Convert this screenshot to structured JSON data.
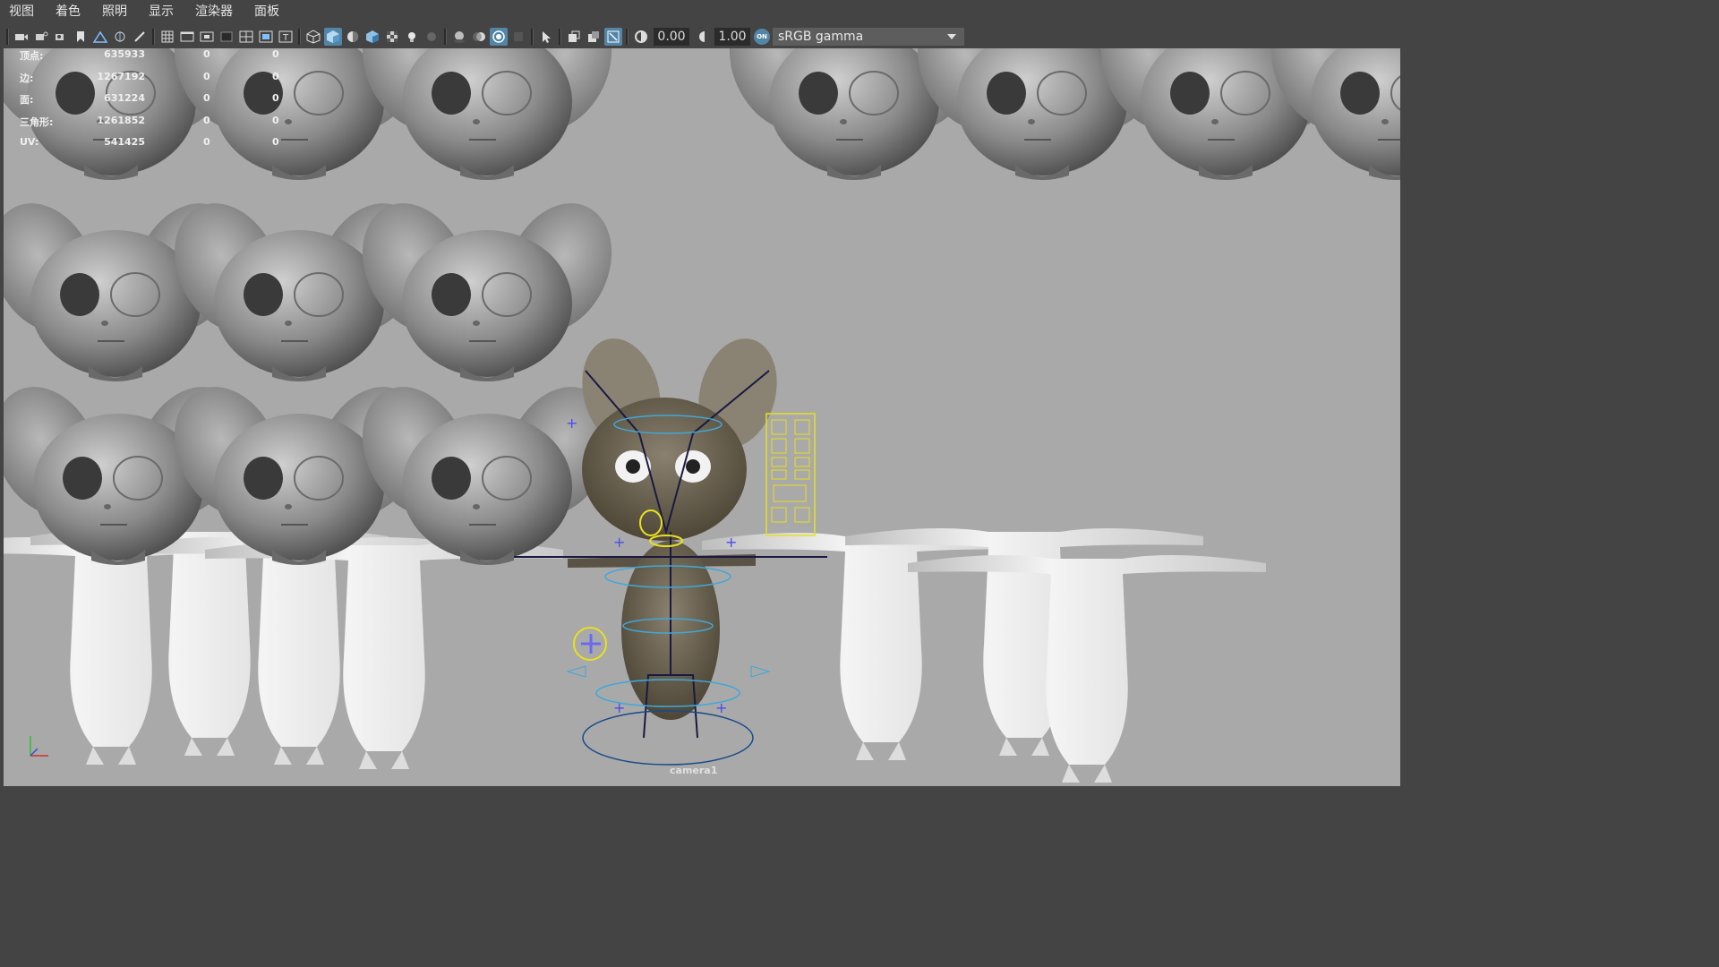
{
  "menu": {
    "items": [
      {
        "label": "视图"
      },
      {
        "label": "着色"
      },
      {
        "label": "照明"
      },
      {
        "label": "显示"
      },
      {
        "label": "渲染器"
      },
      {
        "label": "面板"
      }
    ]
  },
  "toolbar": {
    "exposure_value": "0.00",
    "gamma_value": "1.00",
    "color_management_badge": "ON",
    "view_transform": "sRGB gamma"
  },
  "hud": {
    "rows": [
      {
        "label": "顶点:",
        "v1": "635933",
        "v2": "0",
        "v3": "0"
      },
      {
        "label": "边:",
        "v1": "1267192",
        "v2": "0",
        "v3": "0"
      },
      {
        "label": "面:",
        "v1": "631224",
        "v2": "0",
        "v3": "0"
      },
      {
        "label": "三角形:",
        "v1": "1261852",
        "v2": "0",
        "v3": "0"
      },
      {
        "label": "UV:",
        "v1": "541425",
        "v2": "0",
        "v3": "0"
      }
    ]
  },
  "viewport": {
    "camera_name": "camera1",
    "background_color": "#a9a9a9",
    "selection_color": "#e8e020",
    "control_color": "#3fa8d8"
  }
}
